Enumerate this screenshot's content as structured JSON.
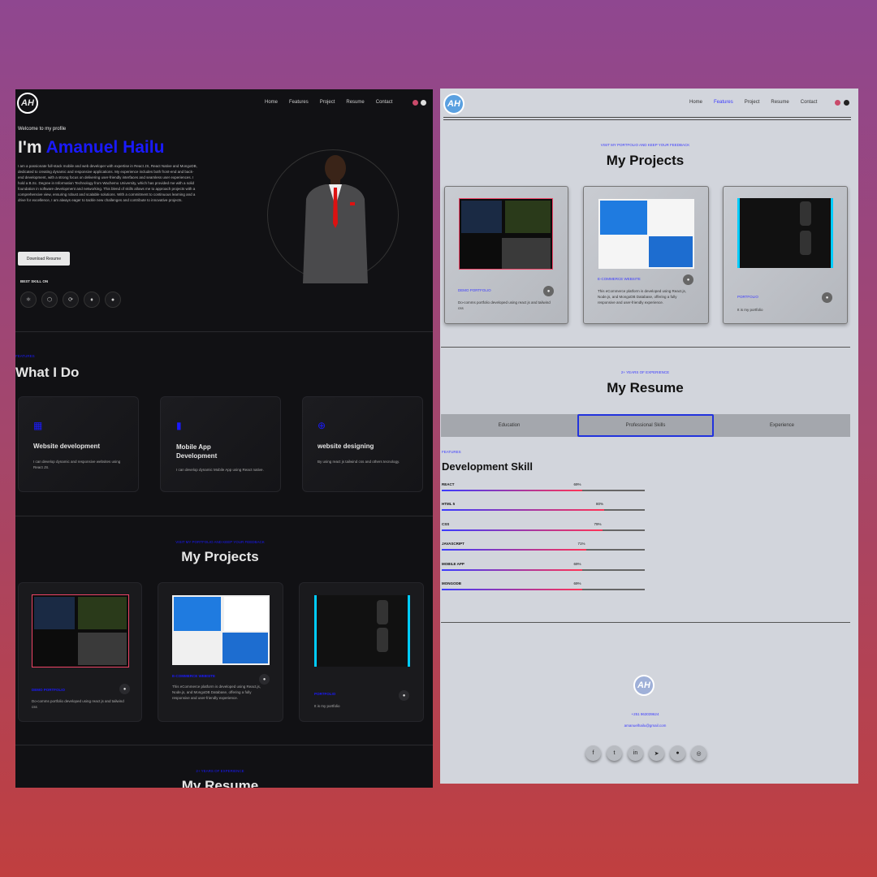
{
  "dark": {
    "logo": "AH",
    "nav": [
      "Home",
      "Features",
      "Project",
      "Resume",
      "Contact"
    ],
    "welcome": "Welcome to my profile",
    "greeting": "I'm ",
    "name": "Amanuel Hailu",
    "bio": "I am a passionate full-stack mobile and web developer with expertise in React JS, React Native and MongoDB, dedicated to creating dynamic and responsive applications. My experience includes both front-end and back-end development, with a strong focus on delivering user-friendly interfaces and seamless user experiences. I hold a B.Sc. Degree in Information Technology from Wachemo University, which has provided me with a solid foundation in software development and networking. This blend of skills allows me to approach projects with a comprehensive view, ensuring robust and scalable solutions. With a commitment to continuous learning and a drive for excellence, I am always eager to tackle new challenges and contribute to innovative projects.",
    "download_btn": "Download Resume",
    "best_skill": "BEST SKILL ON",
    "skills_icons": [
      "react-icon",
      "node-icon",
      "redux-icon",
      "mongodb-icon",
      "github-icon"
    ],
    "features_kicker": "FEATURES",
    "what_i_do": "What I Do",
    "services": [
      {
        "icon": "grid-icon",
        "title": "Website development",
        "desc": "I can develop dynamic and responsive websites using React JS."
      },
      {
        "icon": "mobile-icon",
        "title": "Mobile App Development",
        "desc": "I can develop dynamic Mobile App using React native."
      },
      {
        "icon": "globe-icon",
        "title": "website designing",
        "desc": "By using react js tailwind css and others tecnology."
      }
    ],
    "projects_kicker": "VISIT MY PORTFOLIO AND KEEP YOUR FEEDBACK",
    "projects_title": "My Projects",
    "projects": [
      {
        "title": "DEMO PORTFOLIO",
        "desc": "Do-comms portfolio developed using react js and tailwind css"
      },
      {
        "title": "E-COMMERCE WEBSITE",
        "desc": "This eCommerce platform is developed using React.js, Node.js, and MongoDB Database, offering a fully responsive and user-friendly experience."
      },
      {
        "title": "PORTFOLIO",
        "desc": "It is my portfolio"
      }
    ],
    "resume_kicker": "2+ YEARS OF EXPERIENCE",
    "resume_title": "My Resume"
  },
  "light": {
    "logo": "AH",
    "nav": [
      "Home",
      "Features",
      "Project",
      "Resume",
      "Contact"
    ],
    "projects_kicker": "VISIT MY PORTFOLIO AND KEEP YOUR FEEDBACK",
    "projects_title": "My Projects",
    "projects": [
      {
        "title": "DEMO PORTFOLIO",
        "desc": "Do-comms portfolio developed using react js and tailwind css"
      },
      {
        "title": "E-COMMERCE WEBSITE",
        "desc": "This eCommerce platform is developed using React.js, Node.js, and MongoDB Database, offering a fully responsive and user-friendly experience."
      },
      {
        "title": "PORTFOLIO",
        "desc": "It is my portfolio"
      }
    ],
    "resume_kicker": "2+ YEARS OF EXPERIENCE",
    "resume_title": "My Resume",
    "tabs": [
      "Education",
      "Professional Skills",
      "Experience"
    ],
    "skill_kicker": "FEATURES",
    "skill_title": "Development Skill",
    "skills": [
      {
        "name": "REACT",
        "value": "69%",
        "pct": 0.69
      },
      {
        "name": "HTML 5",
        "value": "80%",
        "pct": 0.8
      },
      {
        "name": "CSS",
        "value": "79%",
        "pct": 0.79
      },
      {
        "name": "JAVASCRIPT",
        "value": "71%",
        "pct": 0.71
      },
      {
        "name": "MOBILE APP",
        "value": "69%",
        "pct": 0.69
      },
      {
        "name": "MONGODB",
        "value": "69%",
        "pct": 0.69
      }
    ],
    "footer_phone": "+251 963039624",
    "footer_email": "amanuelhailu@gmail.com",
    "footer_socials": [
      "facebook-icon",
      "twitter-icon",
      "linkedin-icon",
      "telegram-icon",
      "github-icon",
      "instagram-icon"
    ]
  },
  "colors": {
    "accent": "#1a1aff",
    "dark_bg": "#111114",
    "light_bg": "#d2d5dc"
  }
}
